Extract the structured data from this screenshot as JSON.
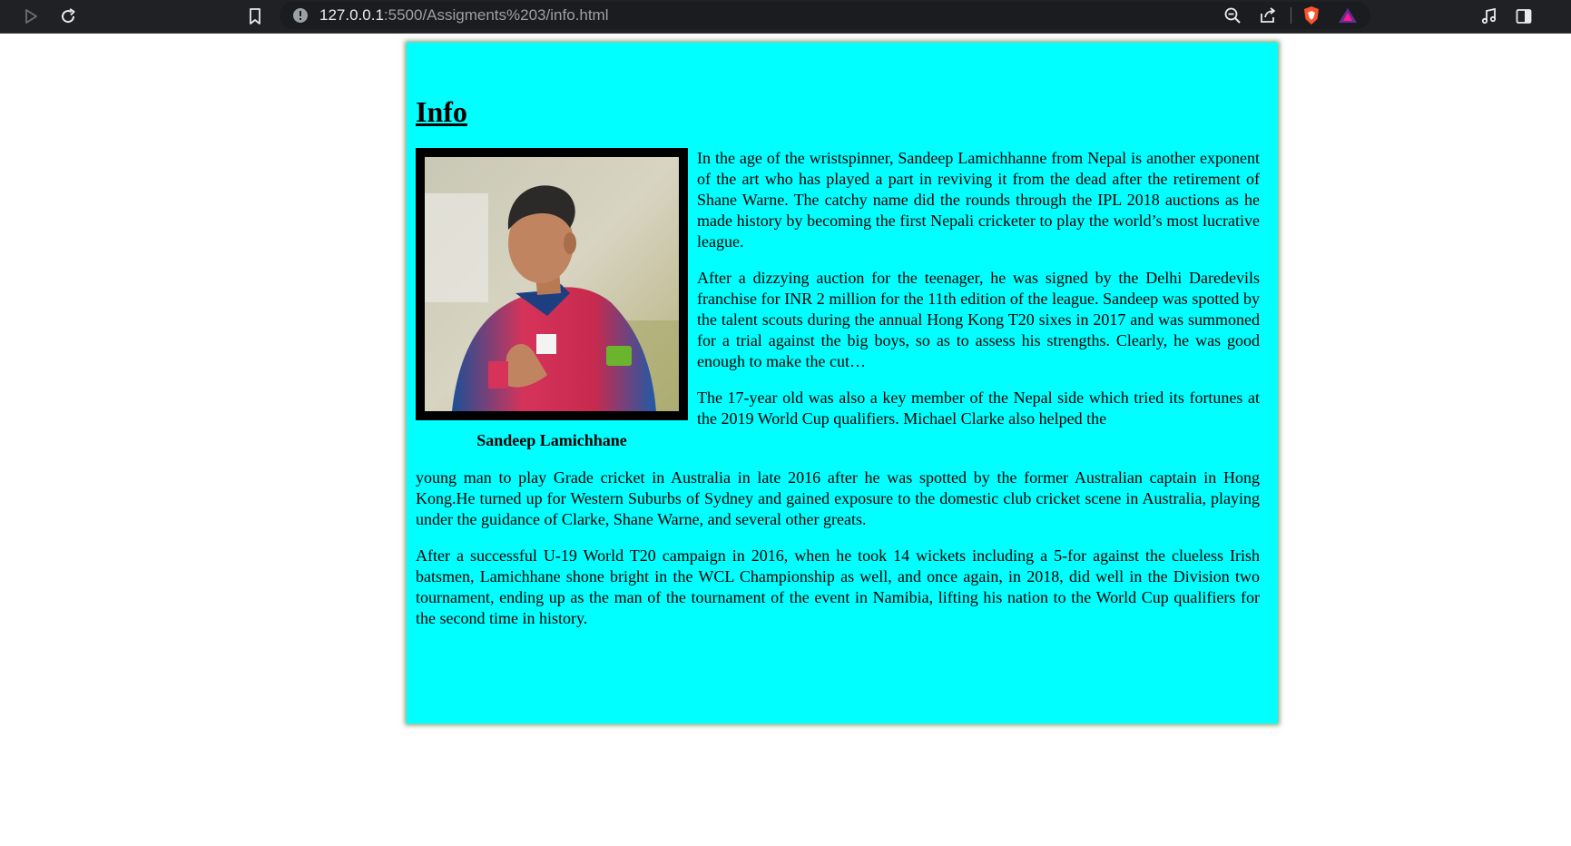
{
  "browser": {
    "url_host": "127.0.0.1",
    "url_rest": ":5500/Assigments%203/info.html",
    "icons": [
      "play-icon",
      "reload-icon",
      "bookmark-icon",
      "site-info-icon",
      "zoom-out-icon",
      "share-icon",
      "brave-shield-icon",
      "brave-rewards-icon",
      "media-icon",
      "sidebar-icon"
    ]
  },
  "page": {
    "heading": "Info",
    "figure_caption": "Sandeep Lamichhane",
    "paragraphs": [
      "In the age of the wristspinner, Sandeep Lamichhanne from Nepal is another exponent of the art who has played a part in reviving it from the dead after the retirement of Shane Warne. The catchy name did the rounds through the IPL 2018 auctions as he made history by becoming the first Nepali cricketer to play the world’s most lucrative league.",
      "After a dizzying auction for the teenager, he was signed by the Delhi Daredevils franchise for INR 2 million for the 11th edition of the league. Sandeep was spotted by the talent scouts during the annual Hong Kong T20 sixes in 2017 and was summoned for a trial against the big boys, so as to assess his strengths. Clearly, he was good enough to make the cut…",
      "The 17-year old was also a key member of the Nepal side which tried its fortunes at the 2019 World Cup qualifiers. Michael Clarke also helped the",
      "young man to play Grade cricket in Australia in late 2016 after he was spotted by the former Australian captain in Hong Kong.He turned up for Western Suburbs of Sydney and gained exposure to the domestic club cricket scene in Australia, playing under the guidance of Clarke, Shane Warne, and several other greats.",
      "After a successful U-19 World T20 campaign in 2016, when he took 14 wickets including a 5-for against the clueless Irish batsmen, Lamichhane shone bright in the WCL Championship as well, and once again, in 2018, did well in the Division two tournament, ending up as the man of the tournament of the event in Namibia, lifting his nation to the World Cup qualifiers for the second time in history."
    ]
  },
  "colors": {
    "card_background": "#00ffff",
    "chrome_background": "#202124",
    "photo_frame": "#000000"
  }
}
